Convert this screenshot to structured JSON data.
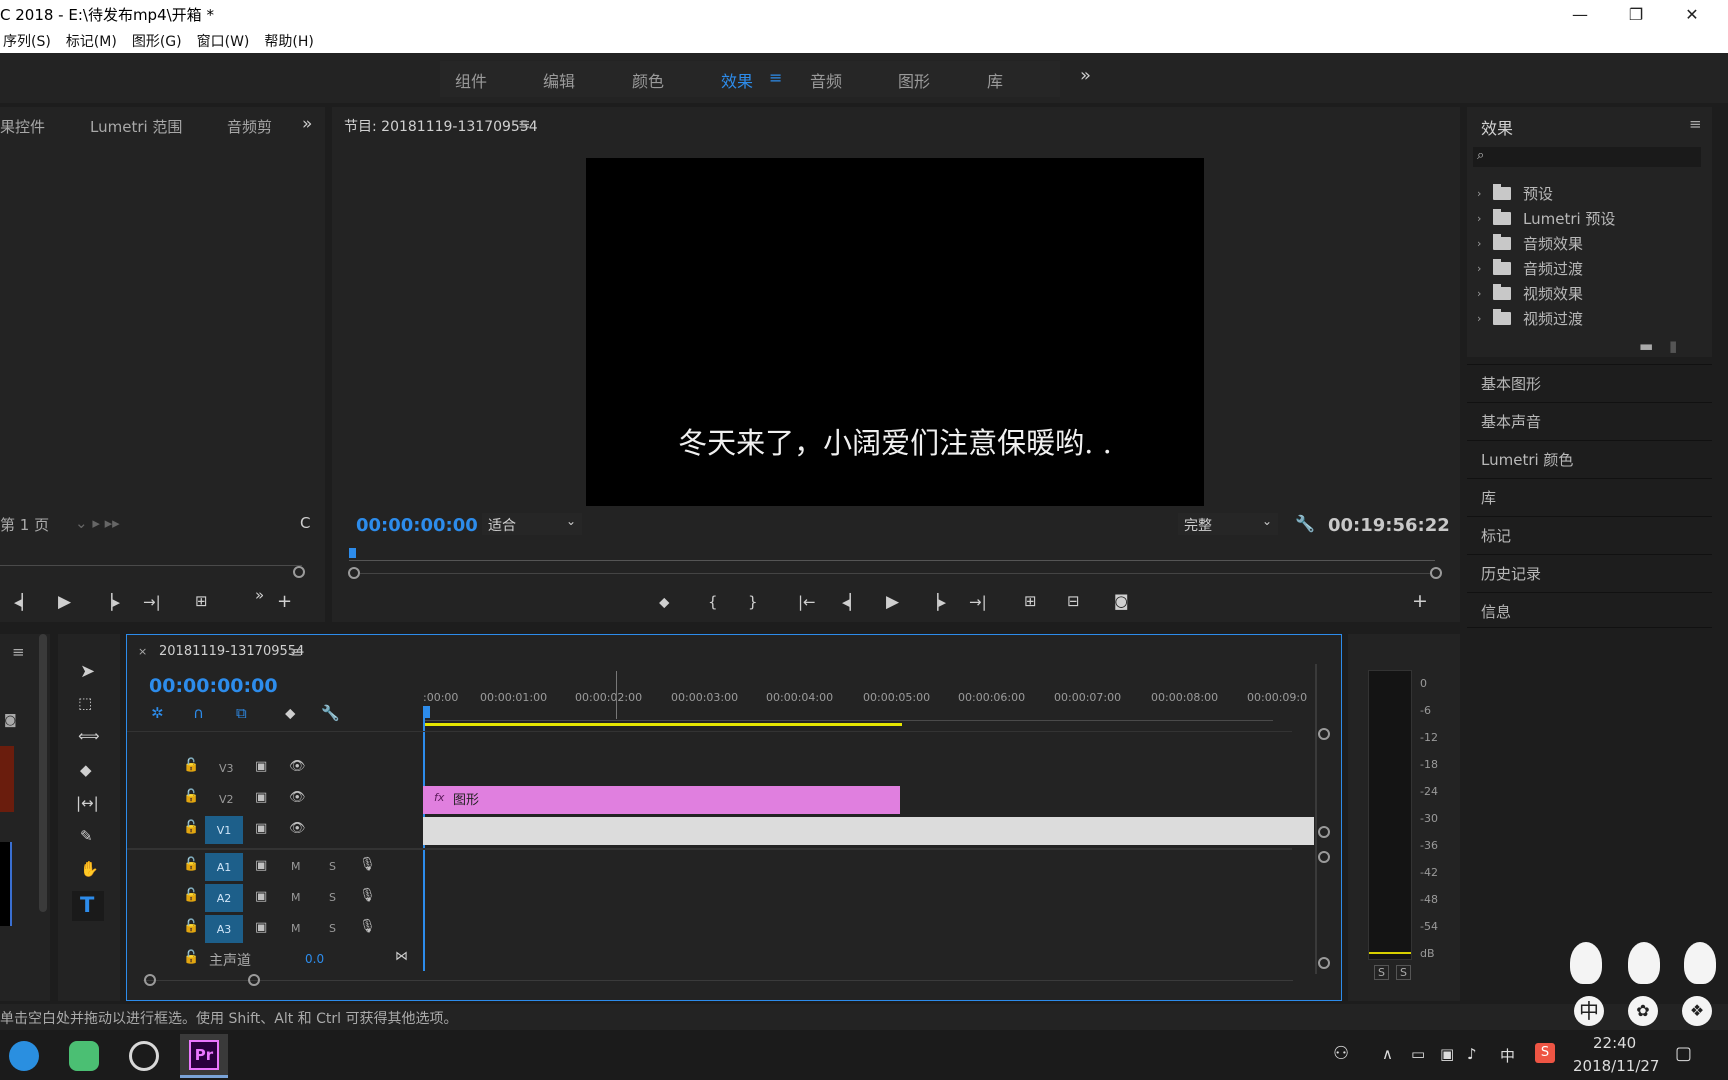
{
  "titlebar": {
    "title": "C 2018 - E:\\待发布mp4\\开箱 *"
  },
  "menu": [
    "序列(S)",
    "标记(M)",
    "图形(G)",
    "窗口(W)",
    "帮助(H)"
  ],
  "workspaces": {
    "tabs": [
      "组件",
      "编辑",
      "颜色",
      "效果",
      "音频",
      "图形",
      "库"
    ],
    "active": "效果",
    "more": "»"
  },
  "source_panel": {
    "tabs": [
      "果控件",
      "Lumetri 范围",
      "音频剪"
    ],
    "page_label": "第 1 页",
    "right_digit": "C"
  },
  "program_monitor": {
    "title": "节目: 20181119-131709554",
    "subtitle": "冬天来了，小阔爱们注意保暖哟. .",
    "timecode": "00:00:00:00",
    "fit": "适合",
    "quality": "完整",
    "duration": "00:19:56:22"
  },
  "effects_panel": {
    "title": "效果",
    "items": [
      "预设",
      "Lumetri 预设",
      "音频效果",
      "音频过渡",
      "视频效果",
      "视频过渡"
    ],
    "sub_panels": [
      "基本图形",
      "基本声音",
      "Lumetri 颜色",
      "库",
      "标记",
      "历史记录",
      "信息"
    ]
  },
  "timeline": {
    "sequence_name": "20181119-131709554",
    "timecode": "00:00:00:00",
    "ruler": [
      ":00:00",
      "00:00:01:00",
      "00:00:02:00",
      "00:00:03:00",
      "00:00:04:00",
      "00:00:05:00",
      "00:00:06:00",
      "00:00:07:00",
      "00:00:08:00",
      "00:00:09:0"
    ],
    "video_tracks": [
      "V3",
      "V2",
      "V1"
    ],
    "audio_tracks": [
      "A1",
      "A2",
      "A3"
    ],
    "master_label": "主声道",
    "master_value": "0.0",
    "clip": {
      "fx": "fx",
      "label": "图形",
      "color": "#e07fdf"
    },
    "track_m": "M",
    "track_s": "S"
  },
  "meter": {
    "scale": [
      "0",
      "-6",
      "-12",
      "-18",
      "-24",
      "-30",
      "-36",
      "-42",
      "-48",
      "-54",
      "dB"
    ],
    "solo": [
      "S",
      "S"
    ]
  },
  "status_bar": {
    "text": "单击空白处并拖动以进行框选。使用 Shift、Alt 和 Ctrl 可获得其他选项。"
  },
  "taskbar": {
    "time": "22:40",
    "date": "2018/11/27",
    "ime": "中"
  },
  "overlay": {
    "ime_char": "中"
  }
}
